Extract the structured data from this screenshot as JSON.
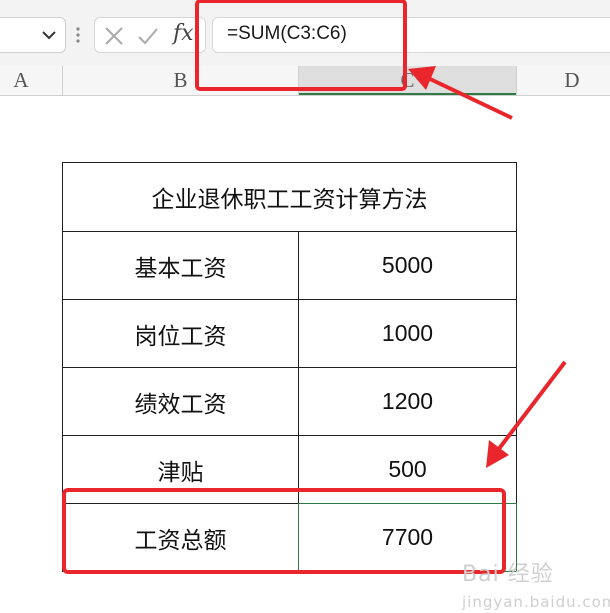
{
  "formula_bar": {
    "cancel_icon": "x-icon",
    "confirm_icon": "check-icon",
    "fx_label": "fx",
    "formula": "=SUM(C3:C6)"
  },
  "columns": [
    "A",
    "B",
    "C",
    "D"
  ],
  "table": {
    "title": "企业退休职工工资计算方法",
    "rows": [
      {
        "label": "基本工资",
        "value": "5000"
      },
      {
        "label": "岗位工资",
        "value": "1000"
      },
      {
        "label": "绩效工资",
        "value": "1200"
      },
      {
        "label": "津贴",
        "value": "500"
      },
      {
        "label": "工资总额",
        "value": "7700"
      }
    ]
  },
  "annotation_color": "#e8262b",
  "selection_color": "#2f7a45",
  "watermark": {
    "brand": "Bai",
    "text": "经验",
    "sub": "jingyan.baidu.com"
  }
}
